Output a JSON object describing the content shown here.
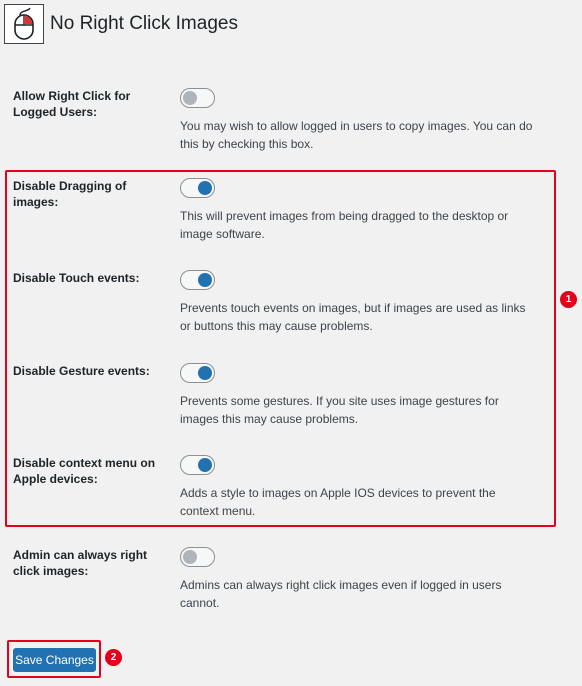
{
  "header": {
    "title": "No Right Click Images",
    "logo_icon": "mouse-icon"
  },
  "settings": [
    {
      "label": "Allow Right Click for Logged Users:",
      "enabled": false,
      "description": "You may wish to allow logged in users to copy images. You can do this by checking this box."
    },
    {
      "label": "Disable Dragging of images:",
      "enabled": true,
      "description": "This will prevent images from being dragged to the desktop or image software."
    },
    {
      "label": "Disable Touch events:",
      "enabled": true,
      "description": "Prevents touch events on images, but if images are used as links or buttons this may cause problems."
    },
    {
      "label": "Disable Gesture events:",
      "enabled": true,
      "description": "Prevents some gestures. If you site uses image gestures for images this may cause problems."
    },
    {
      "label": "Disable context menu on Apple devices:",
      "enabled": true,
      "description": "Adds a style to images on Apple IOS devices to prevent the context menu."
    },
    {
      "label": "Admin can always right click images:",
      "enabled": false,
      "description": "Admins can always right click images even if logged in users cannot."
    }
  ],
  "annotations": {
    "badge_1": "1",
    "badge_2": "2"
  },
  "actions": {
    "save_label": "Save Changes"
  },
  "colors": {
    "accent": "#2271b1",
    "highlight": "#e2001a",
    "toggle_off": "#b0b3b7"
  }
}
